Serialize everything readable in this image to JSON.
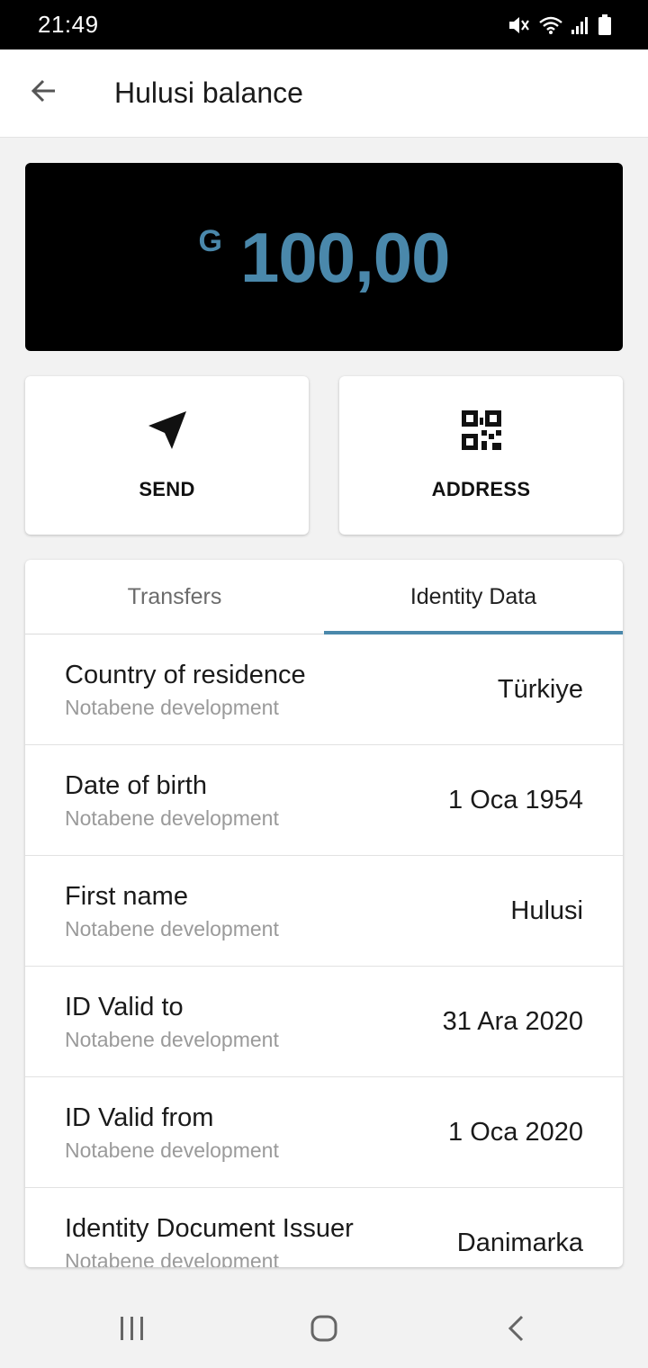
{
  "status_bar": {
    "time": "21:49",
    "icons": [
      "mute-icon",
      "wifi-icon",
      "signal-icon",
      "battery-icon"
    ]
  },
  "app_bar": {
    "back_icon": "arrow-left-icon",
    "title": "Hulusi balance"
  },
  "balance": {
    "currency_symbol": "G",
    "amount": "100,00",
    "color": "#4a88ab"
  },
  "actions": [
    {
      "label": "SEND",
      "icon": "send-icon"
    },
    {
      "label": "ADDRESS",
      "icon": "qr-code-icon"
    }
  ],
  "tabs": [
    {
      "label": "Transfers",
      "active": false
    },
    {
      "label": "Identity Data",
      "active": true
    }
  ],
  "accent_color": "#4a88ab",
  "identity_rows": [
    {
      "title": "Country of residence",
      "subtitle": "Notabene development",
      "value": "Türkiye"
    },
    {
      "title": "Date of birth",
      "subtitle": "Notabene development",
      "value": "1 Oca 1954"
    },
    {
      "title": "First name",
      "subtitle": "Notabene development",
      "value": "Hulusi"
    },
    {
      "title": "ID Valid to",
      "subtitle": "Notabene development",
      "value": "31 Ara 2020"
    },
    {
      "title": "ID Valid from",
      "subtitle": "Notabene development",
      "value": "1 Oca 2020"
    },
    {
      "title": "Identity Document Issuer",
      "subtitle": "Notabene development",
      "value": "Danimarka"
    }
  ],
  "nav_bar": {
    "icons": [
      "recent-apps-icon",
      "home-icon",
      "back-nav-icon"
    ]
  }
}
